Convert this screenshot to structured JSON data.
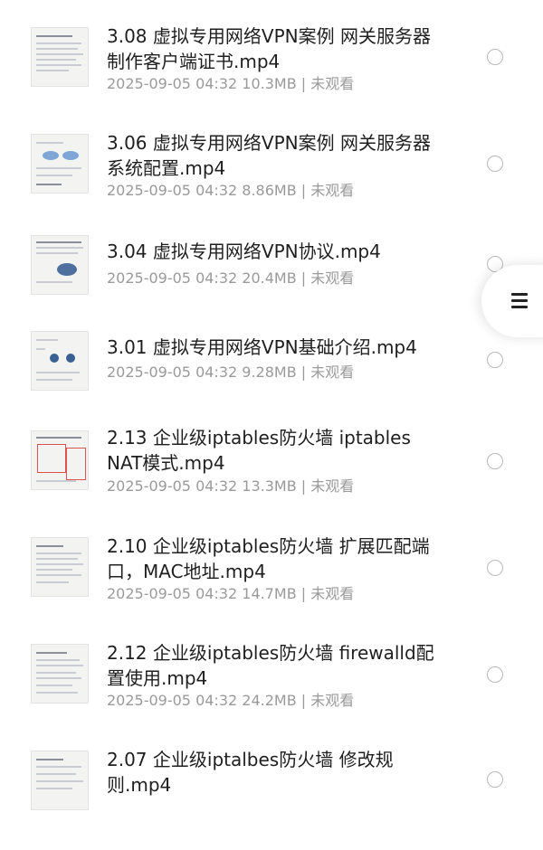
{
  "items": [
    {
      "title": "3.08 虚拟专用网络VPN案例 网关服务器制作客户端证书.mp4",
      "date": "2025-09-05 04:32",
      "size": "10.3MB",
      "status": "未观看"
    },
    {
      "title": "3.06 虚拟专用网络VPN案例 网关服务器系统配置.mp4",
      "date": "2025-09-05 04:32",
      "size": "8.86MB",
      "status": "未观看"
    },
    {
      "title": "3.04 虚拟专用网络VPN协议.mp4",
      "date": "2025-09-05 04:32",
      "size": "20.4MB",
      "status": "未观看"
    },
    {
      "title": "3.01 虚拟专用网络VPN基础介绍.mp4",
      "date": "2025-09-05 04:32",
      "size": "9.28MB",
      "status": "未观看"
    },
    {
      "title": "2.13 企业级iptables防火墙 iptables NAT模式.mp4",
      "date": "2025-09-05 04:32",
      "size": "13.3MB",
      "status": "未观看"
    },
    {
      "title": "2.10 企业级iptables防火墙 扩展匹配端口，MAC地址.mp4",
      "date": "2025-09-05 04:32",
      "size": "14.7MB",
      "status": "未观看"
    },
    {
      "title": "2.12 企业级iptables防火墙 firewalld配置使用.mp4",
      "date": "2025-09-05 04:32",
      "size": "24.2MB",
      "status": "未观看"
    },
    {
      "title": "2.07 企业级iptalbes防火墙 修改规则.mp4",
      "date": "",
      "size": "",
      "status": ""
    }
  ],
  "separator": "|",
  "floating_menu": {
    "icon": "menu-icon"
  }
}
